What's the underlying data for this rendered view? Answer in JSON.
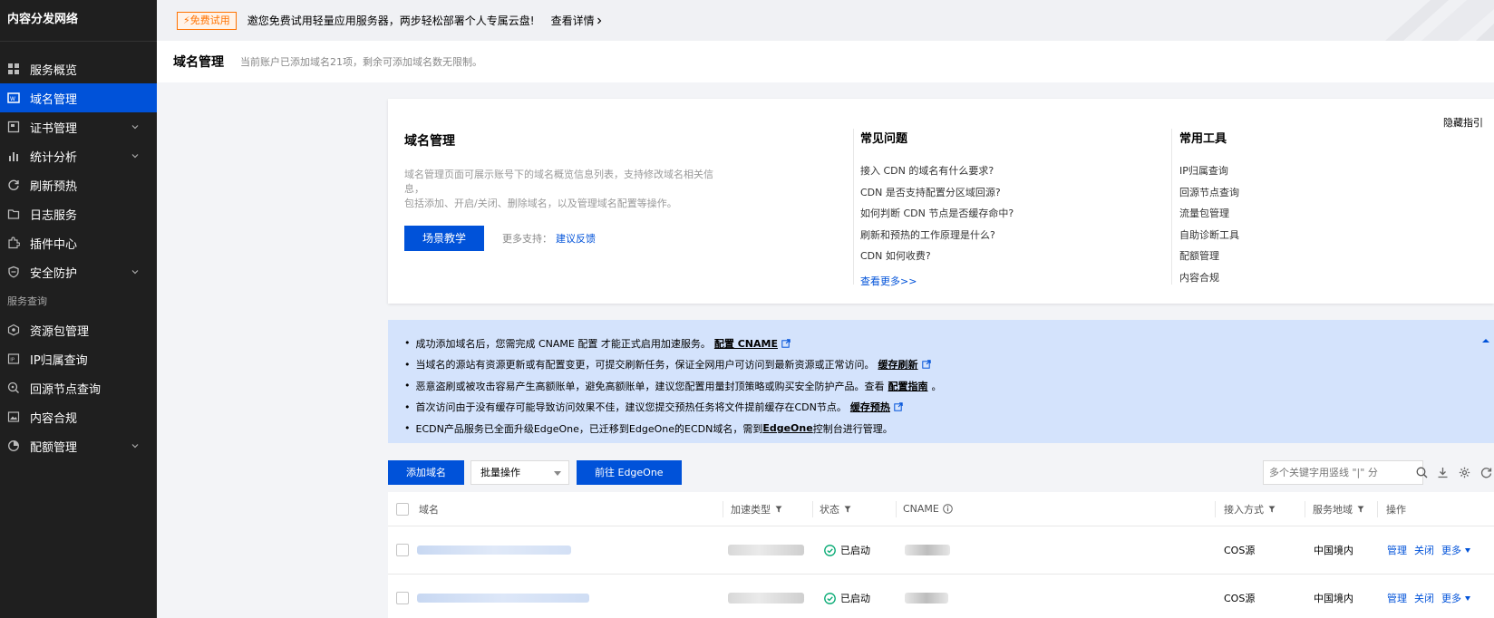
{
  "sidebar": {
    "title": "内容分发网络",
    "items": [
      {
        "label": "服务概览",
        "icon": "grid-icon",
        "expandable": false,
        "active": false
      },
      {
        "label": "域名管理",
        "icon": "domain-icon",
        "expandable": false,
        "active": true
      },
      {
        "label": "证书管理",
        "icon": "certificate-icon",
        "expandable": true,
        "active": false
      },
      {
        "label": "统计分析",
        "icon": "bar-chart-icon",
        "expandable": true,
        "active": false
      },
      {
        "label": "刷新预热",
        "icon": "refresh-icon",
        "expandable": false,
        "active": false
      },
      {
        "label": "日志服务",
        "icon": "folder-icon",
        "expandable": false,
        "active": false
      },
      {
        "label": "插件中心",
        "icon": "plugin-icon",
        "expandable": false,
        "active": false
      },
      {
        "label": "安全防护",
        "icon": "shield-icon",
        "expandable": true,
        "active": false
      }
    ],
    "group_label": "服务查询",
    "group_items": [
      {
        "label": "资源包管理",
        "icon": "package-icon",
        "expandable": false
      },
      {
        "label": "IP归属查询",
        "icon": "ip-icon",
        "expandable": false
      },
      {
        "label": "回源节点查询",
        "icon": "search-node-icon",
        "expandable": false
      },
      {
        "label": "内容合规",
        "icon": "image-icon",
        "expandable": false
      },
      {
        "label": "配额管理",
        "icon": "pie-chart-icon",
        "expandable": true
      }
    ]
  },
  "banner": {
    "badge": "免费试用",
    "text": "邀您免费试用轻量应用服务器，两步轻松部署个人专属云盘!",
    "link": "查看详情"
  },
  "header": {
    "title": "域名管理",
    "subtitle": "当前账户已添加域名21项，剩余可添加域名数无限制。"
  },
  "guide": {
    "title": "域名管理",
    "desc_line1": "域名管理页面可展示账号下的域名概览信息列表，支持修改域名相关信息，",
    "desc_line2": "包括添加、开启/关闭、删除域名，以及管理域名配置等操作。",
    "button": "场景教学",
    "more_label": "更多支持：",
    "feedback_link": "建议反馈",
    "hide": "隐藏指引",
    "faq_title": "常见问题",
    "faq": [
      "接入 CDN 的域名有什么要求?",
      "CDN 是否支持配置分区域回源?",
      "如何判断 CDN 节点是否缓存命中?",
      "刷新和预热的工作原理是什么?",
      "CDN 如何收费?"
    ],
    "faq_more": "查看更多>>",
    "tools_title": "常用工具",
    "tools": [
      "IP归属查询",
      "回源节点查询",
      "流量包管理",
      "自助诊断工具",
      "配额管理",
      "内容合规"
    ]
  },
  "notice": {
    "lines": [
      {
        "text": "成功添加域名后，您需完成 CNAME 配置 才能正式启用加速服务。",
        "link": "配置 CNAME",
        "ext": true,
        "after": ""
      },
      {
        "text": "当域名的源站有资源更新或有配置变更，可提交刷新任务，保证全网用户可访问到最新资源或正常访问。",
        "link": "缓存刷新",
        "ext": true,
        "after": ""
      },
      {
        "text": "恶意盗刷或被攻击容易产生高额账单，避免高额账单，建议您配置用量封顶策略或购买安全防护产品。查看",
        "link": "配置指南",
        "ext": false,
        "after": "。"
      },
      {
        "text": "首次访问由于没有缓存可能导致访问效果不佳，建议您提交预热任务将文件提前缓存在CDN节点。",
        "link": "缓存预热",
        "ext": true,
        "after": ""
      },
      {
        "text": "ECDN产品服务已全面升级EdgeOne，已迁移到EdgeOne的ECDN域名，需到",
        "link": "EdgeOne",
        "ext": false,
        "after": "控制台进行管理。"
      }
    ]
  },
  "toolbar": {
    "add_button": "添加域名",
    "batch_select": "批量操作",
    "edgeone_button": "前往 EdgeOne",
    "search_placeholder": "多个关键字用竖线 \"|\" 分"
  },
  "table": {
    "headers": {
      "domain": "域名",
      "accel_type": "加速类型",
      "status": "状态",
      "cname": "CNAME",
      "access": "接入方式",
      "region": "服务地域",
      "ops": "操作"
    },
    "rows": [
      {
        "status": "已启动",
        "access": "COS源",
        "region": "中国境内",
        "op1": "管理",
        "op2": "关闭",
        "op3": "更多"
      },
      {
        "status": "已启动",
        "access": "COS源",
        "region": "中国境内",
        "op1": "管理",
        "op2": "关闭",
        "op3": "更多"
      }
    ]
  },
  "colors": {
    "sidebar_bg": "#1f1f1f",
    "accent": "#0052d9",
    "notice_bg": "#d4e3fc",
    "badge": "#ff7200",
    "success": "#00a870"
  }
}
